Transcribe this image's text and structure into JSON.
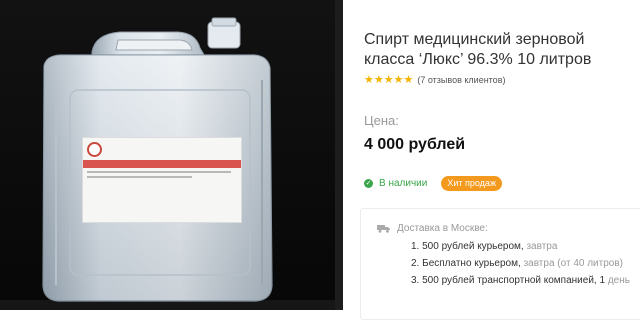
{
  "product": {
    "title": "Спирт медицинский зерновой класса ‘Люкс’ 96.3% 10 литров",
    "rating_stars": 5,
    "reviews": "(7 отзывов клиентов)",
    "price_label": "Цена:",
    "price": "4 000 рублей",
    "stock": "В наличии",
    "badge": "Хит продаж"
  },
  "delivery": {
    "title": "Доставка в Москве:",
    "items": [
      {
        "num": "1.",
        "text": "500 рублей курьером,",
        "note": "завтра"
      },
      {
        "num": "2.",
        "text": "Бесплатно курьером,",
        "note": "завтра (от 40 литров)"
      },
      {
        "num": "3.",
        "text": "500 рублей транспортной компанией, 1",
        "note": "день"
      }
    ]
  },
  "colors": {
    "accent_orange": "#f39a1e",
    "stock_green": "#3aa54a",
    "star_gold": "#f4b400",
    "label_red": "#d9534f"
  },
  "icons": {
    "star": "star-icon",
    "check": "check-circle-icon",
    "truck": "truck-icon"
  }
}
